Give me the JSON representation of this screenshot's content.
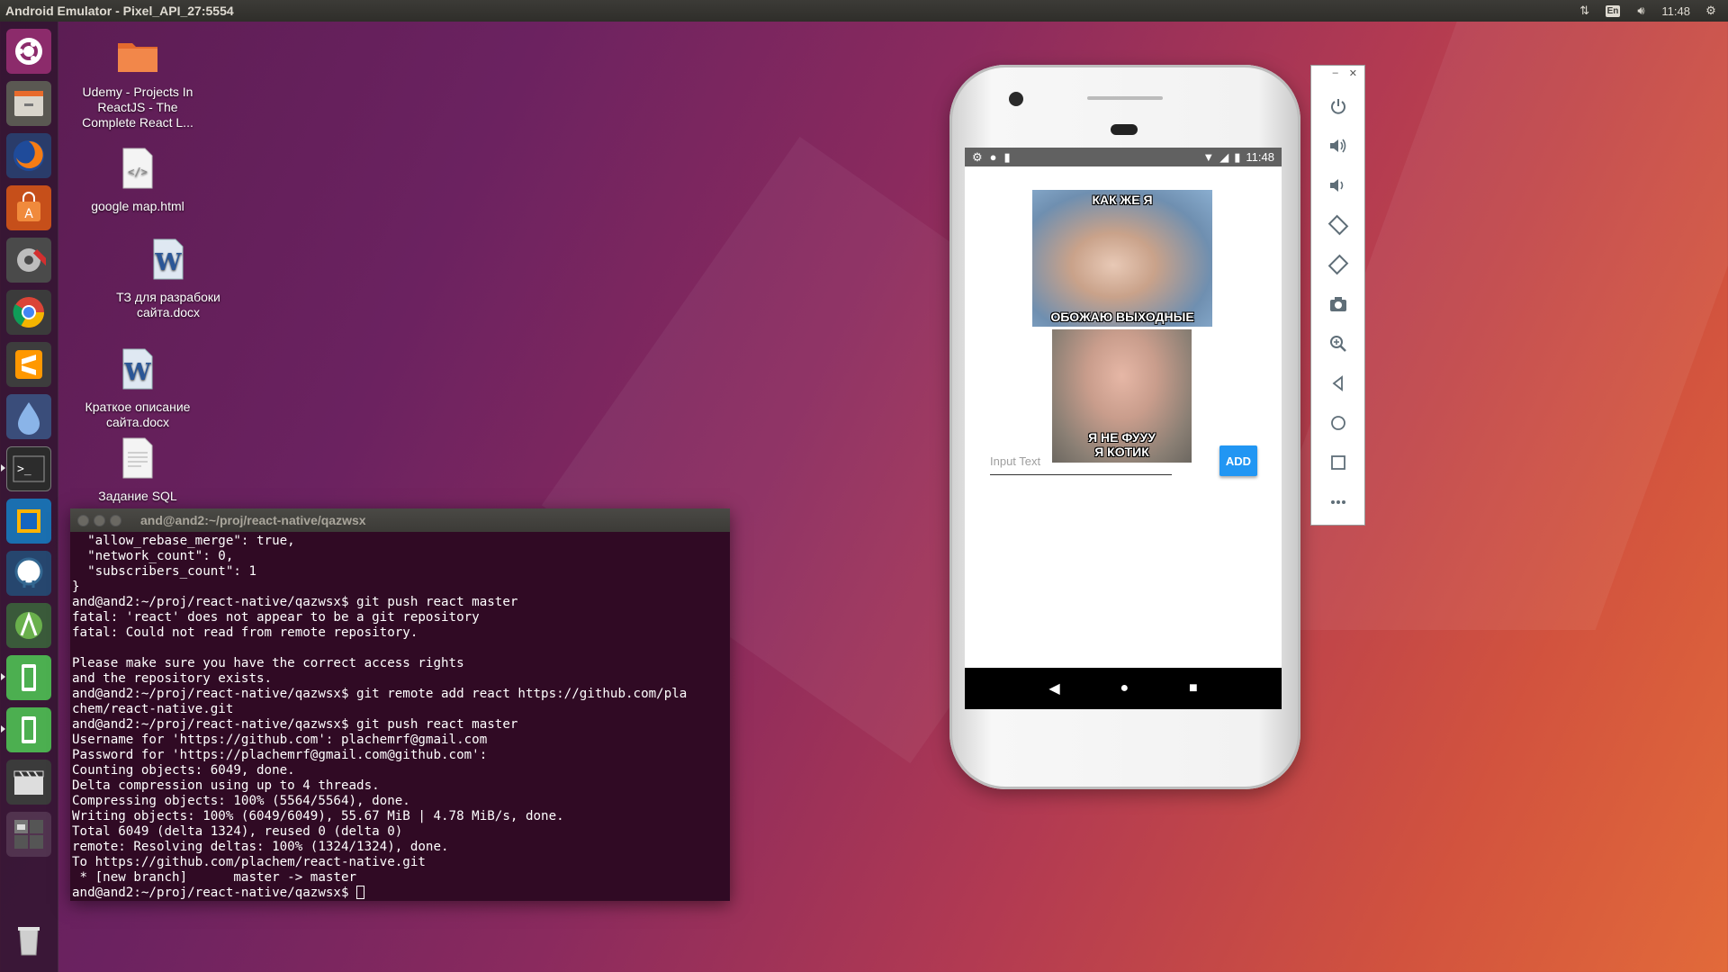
{
  "window_title": "Android Emulator - Pixel_API_27:5554",
  "tray": {
    "keyboard": "En",
    "time": "11:48"
  },
  "desktop_icons": [
    {
      "label": "Udemy - Projects In ReactJS - The Complete React L...",
      "icon": "folder-icon"
    },
    {
      "label": "google map.html",
      "icon": "html-file-icon"
    },
    {
      "label": "ТЗ для разрабоки сайта.docx",
      "icon": "word-doc-icon"
    },
    {
      "label": "Краткое описание сайта.docx",
      "icon": "word-doc-icon"
    },
    {
      "label": "Задание SQL",
      "icon": "text-file-icon"
    }
  ],
  "terminal": {
    "title": "and@and2:~/proj/react-native/qazwsx",
    "lines": [
      "  \"allow_rebase_merge\": true,",
      "  \"network_count\": 0,",
      "  \"subscribers_count\": 1",
      "}",
      "and@and2:~/proj/react-native/qazwsx$ git push react master",
      "fatal: 'react' does not appear to be a git repository",
      "fatal: Could not read from remote repository.",
      "",
      "Please make sure you have the correct access rights",
      "and the repository exists.",
      "and@and2:~/proj/react-native/qazwsx$ git remote add react https://github.com/pla",
      "chem/react-native.git",
      "and@and2:~/proj/react-native/qazwsx$ git push react master",
      "Username for 'https://github.com': plachemrf@gmail.com",
      "Password for 'https://plachemrf@gmail.com@github.com':",
      "Counting objects: 6049, done.",
      "Delta compression using up to 4 threads.",
      "Compressing objects: 100% (5564/5564), done.",
      "Writing objects: 100% (6049/6049), 55.67 MiB | 4.78 MiB/s, done.",
      "Total 6049 (delta 1324), reused 0 (delta 0)",
      "remote: Resolving deltas: 100% (1324/1324), done.",
      "To https://github.com/plachem/react-native.git",
      " * [new branch]      master -> master"
    ],
    "prompt": "and@and2:~/proj/react-native/qazwsx$ "
  },
  "phone": {
    "status_time": "11:48",
    "meme1": {
      "top": "КАК ЖЕ Я",
      "bottom": "ОБОЖАЮ ВЫХОДНЫЕ"
    },
    "meme2": {
      "line1": "Я НЕ ФУУУ",
      "line2": "Я КОТИК"
    },
    "input_placeholder": "Input Text",
    "add_button": "ADD"
  },
  "emulator_tools": [
    "power-icon",
    "volume-up-icon",
    "volume-down-icon",
    "rotate-left-icon",
    "rotate-right-icon",
    "camera-icon",
    "zoom-icon",
    "back-icon",
    "home-icon",
    "overview-icon",
    "more-icon"
  ],
  "colors": {
    "terminal_bg": "#300a24",
    "add_button": "#2196f3",
    "panel": "#3c3b37"
  }
}
